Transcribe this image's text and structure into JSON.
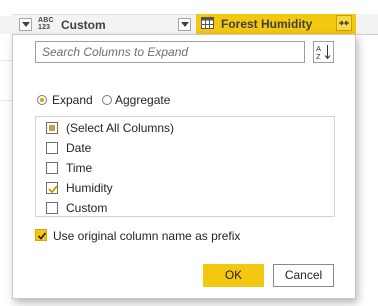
{
  "header": {
    "custom_column": {
      "type_badge_top": "ABC",
      "type_badge_bottom": "123",
      "name": "Custom"
    },
    "forest_column": {
      "name": "Forest Humidity"
    }
  },
  "popup": {
    "search": {
      "placeholder": "Search Columns to Expand",
      "value": ""
    },
    "sort_button_icon": "sort-az-icon",
    "mode": {
      "options": [
        "Expand",
        "Aggregate"
      ],
      "selected": "Expand",
      "expand_label": "Expand",
      "aggregate_label": "Aggregate"
    },
    "columns": [
      {
        "label": "(Select All Columns)",
        "state": "partial"
      },
      {
        "label": "Date",
        "state": "unchecked"
      },
      {
        "label": "Time",
        "state": "unchecked"
      },
      {
        "label": "Humidity",
        "state": "checked"
      },
      {
        "label": "Custom",
        "state": "unchecked"
      }
    ],
    "prefix_option": {
      "label": "Use original column name as prefix",
      "checked": true
    },
    "buttons": {
      "ok": "OK",
      "cancel": "Cancel"
    }
  },
  "colors": {
    "accent": "#f2c811",
    "header_bg": "#f3f3f3",
    "text": "#252525"
  }
}
